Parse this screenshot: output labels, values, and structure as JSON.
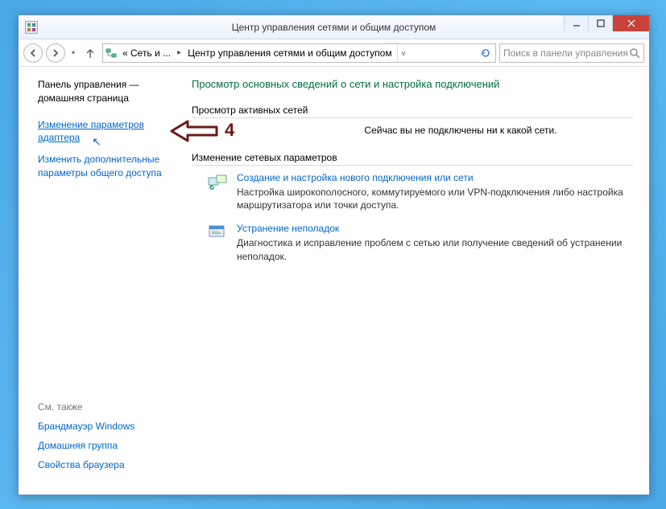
{
  "window": {
    "title": "Центр управления сетями и общим доступом"
  },
  "address": {
    "seg1": "« Сеть и ...",
    "seg2": "Центр управления сетями и общим доступом"
  },
  "search": {
    "placeholder": "Поиск в панели управления"
  },
  "sidebar": {
    "home": "Панель управления — домашняя страница",
    "link_adapter": "Изменение параметров адаптера",
    "link_sharing": "Изменить дополнительные параметры общего доступа",
    "see_also_title": "См. также",
    "see_also": [
      "Брандмауэр Windows",
      "Домашняя группа",
      "Свойства браузера"
    ]
  },
  "main": {
    "heading": "Просмотр основных сведений о сети и настройка подключений",
    "active_title": "Просмотр активных сетей",
    "no_connection": "Сейчас вы не подключены ни к какой сети.",
    "params_title": "Изменение сетевых параметров",
    "task1_link": "Создание и настройка нового подключения или сети",
    "task1_desc": "Настройка широкополосного, коммутируемого или VPN-подключения либо настройка маршрутизатора или точки доступа.",
    "task2_link": "Устранение неполадок",
    "task2_desc": "Диагностика и исправление проблем с сетью или получение сведений об устранении неполадок."
  },
  "annotation": {
    "number": "4"
  }
}
